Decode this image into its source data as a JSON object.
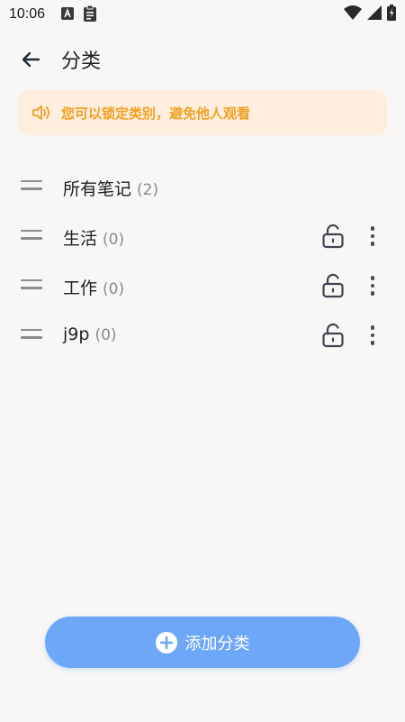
{
  "status_bar": {
    "time": "10:06",
    "left_icons": [
      "font-a-icon",
      "clipboard-icon"
    ],
    "right_icons": [
      "wifi-icon",
      "signal-icon",
      "battery-icon"
    ]
  },
  "header": {
    "back_icon": "arrow-left-icon",
    "title": "分类"
  },
  "notice": {
    "icon": "speaker-icon",
    "text": "您可以锁定类别，避免他人观看",
    "color": "#f2a024",
    "background": "#fdeedd"
  },
  "categories": [
    {
      "name": "所有笔记",
      "count": "(2)",
      "lockable": false
    },
    {
      "name": "生活",
      "count": "(0)",
      "lockable": true
    },
    {
      "name": "工作",
      "count": "(0)",
      "lockable": true
    },
    {
      "name": "j9p",
      "count": "(0)",
      "lockable": true
    }
  ],
  "add_button": {
    "icon": "plus-circle-icon",
    "label": "添加分类",
    "color": "#6ea7f7"
  }
}
